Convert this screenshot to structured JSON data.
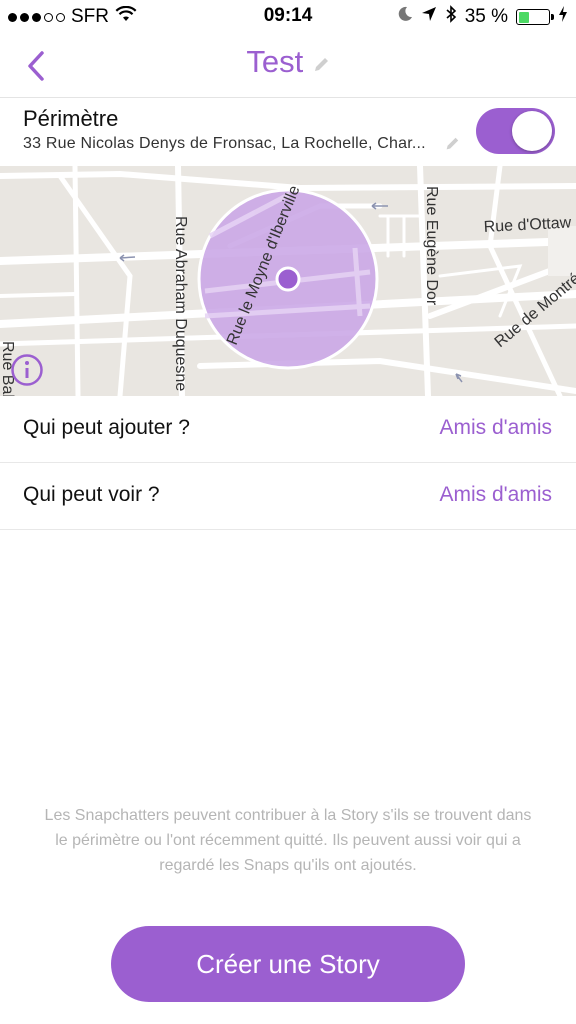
{
  "status_bar": {
    "carrier": "SFR",
    "time": "09:14",
    "battery_percent": "35 %",
    "battery_level": 0.35
  },
  "header": {
    "title": "Test"
  },
  "perimeter": {
    "label": "Périmètre",
    "address": "33 Rue Nicolas Denys de Fronsac, La Rochelle, Char...",
    "enabled": true
  },
  "map": {
    "streets": [
      "Rue le Moyne d'Iberville",
      "Rue Abraham Duquesne",
      "Rue Eugène Dor",
      "Rue d'Ottaw",
      "Rue de Montré",
      "Rue Bab"
    ]
  },
  "settings": [
    {
      "label": "Qui peut ajouter ?",
      "value": "Amis d'amis"
    },
    {
      "label": "Qui peut voir ?",
      "value": "Amis d'amis"
    }
  ],
  "info_text": "Les Snapchatters peuvent contribuer à la Story s'ils se trouvent dans le périmètre ou l'ont récemment quitté. Ils peuvent aussi voir qui a regardé les Snaps qu'ils ont ajoutés.",
  "cta_label": "Créer une Story",
  "colors": {
    "accent": "#9b5fd0",
    "map_background": "#e9e6e1",
    "radius_fill": "#c9a6e6"
  }
}
